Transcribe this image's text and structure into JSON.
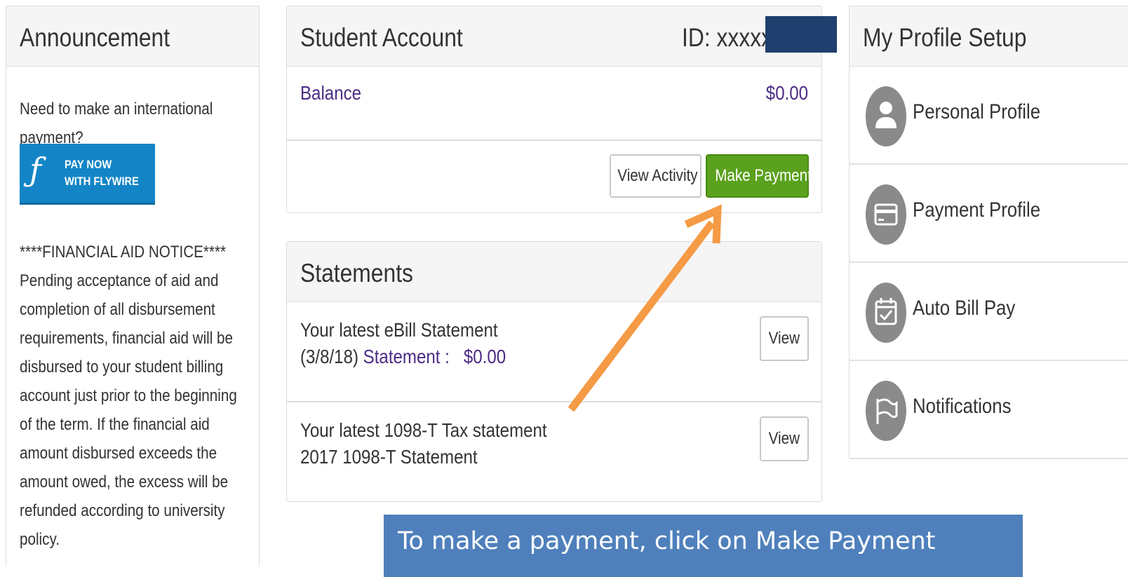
{
  "announcement": {
    "title": "Announcement",
    "intro_line1": "Need to make an international",
    "intro_line2": "payment?",
    "flywire_line1": "PAY NOW",
    "flywire_line2": "WITH FLYWIRE",
    "notice_lines": [
      "****FINANCIAL AID NOTICE****",
      "Pending acceptance of aid and",
      "completion of all disbursement",
      "requirements, financial aid will be",
      "disbursed to your student billing",
      "account just prior to the beginning",
      "of the term. If the financial aid",
      "amount disbursed exceeds the",
      "amount owed, the excess will be",
      "refunded according to university",
      "policy."
    ]
  },
  "student_account": {
    "title": "Student Account",
    "id_label": "ID: xxxxx",
    "balance_label": "Balance",
    "balance_value": "$0.00",
    "view_activity": "View Activity",
    "make_payment": "Make Payment"
  },
  "statements": {
    "title": "Statements",
    "ebill_line1": "Your latest eBill Statement",
    "ebill_date": "(3/8/18)",
    "ebill_link": "Statement :",
    "ebill_amount": "$0.00",
    "tax_line1": "Your latest 1098-T Tax statement",
    "tax_link": "2017 1098-T Statement",
    "view_label": "View"
  },
  "profile": {
    "title": "My Profile Setup",
    "items": [
      {
        "label": "Personal Profile",
        "icon": "person-icon"
      },
      {
        "label": "Payment Profile",
        "icon": "credit-card-icon"
      },
      {
        "label": "Auto Bill Pay",
        "icon": "calendar-check-icon"
      },
      {
        "label": "Notifications",
        "icon": "flag-icon"
      }
    ]
  },
  "callout": {
    "text": "To make a payment, click on Make Payment"
  },
  "colors": {
    "accent_green": "#5aa11d",
    "link_purple": "#4b2c85",
    "flywire_blue": "#1385c6",
    "callout_blue": "#4f80bc",
    "arrow_orange": "#f59a45"
  }
}
